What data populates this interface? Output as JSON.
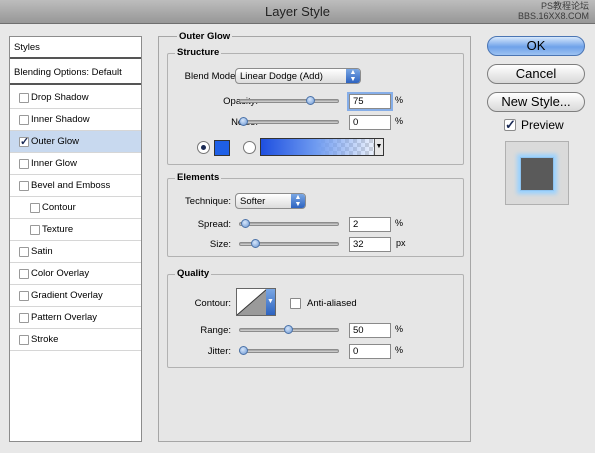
{
  "window": {
    "title": "Layer Style",
    "watermark_line1": "PS教程论坛",
    "watermark_line2": "BBS.16XX8.COM"
  },
  "sidebar": {
    "styles_label": "Styles",
    "blending_label": "Blending Options: Default",
    "items": [
      {
        "label": "Drop Shadow",
        "checked": false,
        "indent": false
      },
      {
        "label": "Inner Shadow",
        "checked": false,
        "indent": false
      },
      {
        "label": "Outer Glow",
        "checked": true,
        "indent": false,
        "selected": true
      },
      {
        "label": "Inner Glow",
        "checked": false,
        "indent": false
      },
      {
        "label": "Bevel and Emboss",
        "checked": false,
        "indent": false
      },
      {
        "label": "Contour",
        "checked": false,
        "indent": true
      },
      {
        "label": "Texture",
        "checked": false,
        "indent": true
      },
      {
        "label": "Satin",
        "checked": false,
        "indent": false
      },
      {
        "label": "Color Overlay",
        "checked": false,
        "indent": false
      },
      {
        "label": "Gradient Overlay",
        "checked": false,
        "indent": false
      },
      {
        "label": "Pattern Overlay",
        "checked": false,
        "indent": false
      },
      {
        "label": "Stroke",
        "checked": false,
        "indent": false
      }
    ]
  },
  "outer_glow": {
    "title": "Outer Glow",
    "structure": {
      "title": "Structure",
      "blend_mode_label": "Blend Mode:",
      "blend_mode_value": "Linear Dodge (Add)",
      "opacity_label": "Opacity:",
      "opacity_value": "75",
      "opacity_unit": "%",
      "opacity_level": 0.75,
      "noise_label": "Noise:",
      "noise_value": "0",
      "noise_unit": "%",
      "noise_level": 0,
      "glow_color": "#1e5fe6"
    },
    "elements": {
      "title": "Elements",
      "technique_label": "Technique:",
      "technique_value": "Softer",
      "spread_label": "Spread:",
      "spread_value": "2",
      "spread_unit": "%",
      "spread_level": 0.02,
      "size_label": "Size:",
      "size_value": "32",
      "size_unit": "px",
      "size_level": 0.13
    },
    "quality": {
      "title": "Quality",
      "contour_label": "Contour:",
      "antialiased_label": "Anti-aliased",
      "range_label": "Range:",
      "range_value": "50",
      "range_unit": "%",
      "range_level": 0.5,
      "jitter_label": "Jitter:",
      "jitter_value": "0",
      "jitter_unit": "%",
      "jitter_level": 0
    }
  },
  "buttons": {
    "ok": "OK",
    "cancel": "Cancel",
    "new_style": "New Style..."
  },
  "preview": {
    "label": "Preview",
    "checked": true
  },
  "colors": {
    "accent": "#6fa2e9",
    "selected_row": "#c8d9ef"
  }
}
